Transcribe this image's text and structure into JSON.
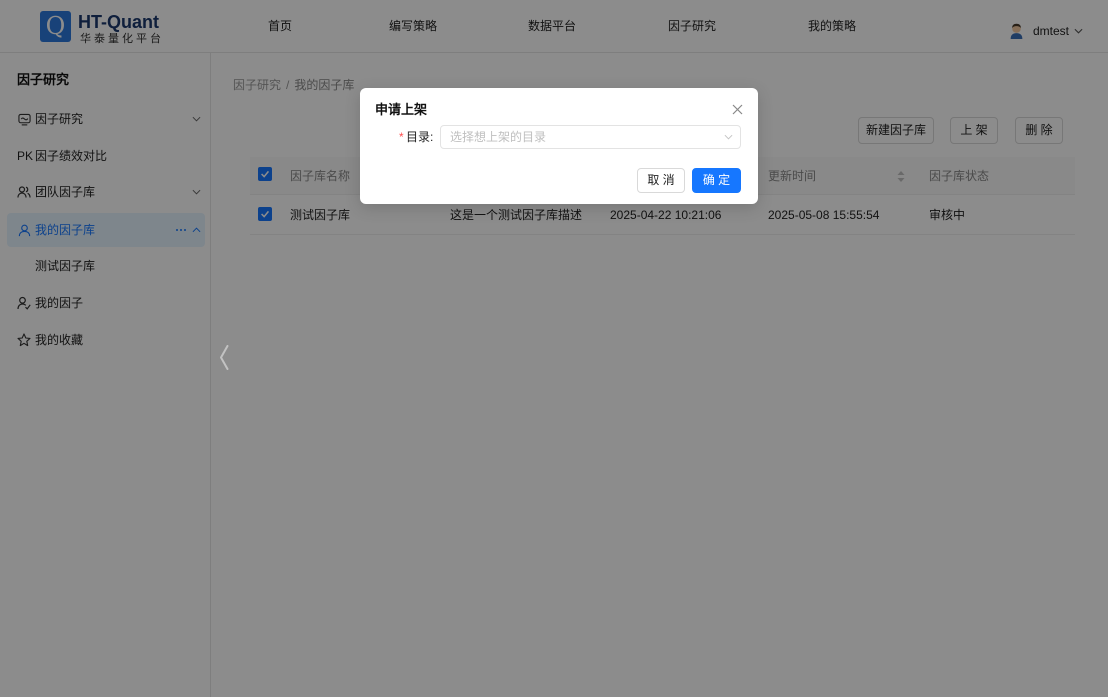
{
  "header": {
    "logo": {
      "mark": "Q",
      "brand": "HT-Quant",
      "subtitle": "华泰量化平台"
    },
    "nav": [
      {
        "label": "首页"
      },
      {
        "label": "编写策略"
      },
      {
        "label": "数据平台"
      },
      {
        "label": "因子研究"
      },
      {
        "label": "我的策略"
      }
    ],
    "user": {
      "name": "dmtest",
      "avatar_icon": "user-avatar-icon",
      "menu_icon": "chevron-down-icon"
    }
  },
  "sidebar": {
    "title": "因子研究",
    "items": [
      {
        "label": "因子研究",
        "icon": "factor-research-icon",
        "expand_icon": "chevron-down-icon"
      },
      {
        "label": "因子绩效对比",
        "icon_text": "PK"
      },
      {
        "label": "团队因子库",
        "icon": "team-icon",
        "expand_icon": "chevron-down-icon"
      },
      {
        "label": "我的因子库",
        "icon": "user-icon",
        "selected": true,
        "more_icon": "ellipsis-icon",
        "expand_icon": "chevron-up-icon"
      },
      {
        "label": "测试因子库"
      },
      {
        "label": "我的因子",
        "icon": "user-check-icon"
      },
      {
        "label": "我的收藏",
        "icon": "star-icon"
      }
    ],
    "collapse_icon": "chevron-left-icon"
  },
  "main": {
    "breadcrumb": {
      "items": [
        "因子研究",
        "我的因子库"
      ],
      "separator": "/"
    },
    "actions": {
      "new_library": "新建因子库",
      "publish": "上 架",
      "delete": "删 除"
    },
    "table": {
      "select_all_checked": true,
      "columns": {
        "name": "因子库名称",
        "updated": "更新时间",
        "status": "因子库状态"
      },
      "sort_icon": "sort-icon",
      "rows": [
        {
          "checked": true,
          "name": "测试因子库",
          "description": "这是一个测试因子库描述",
          "created": "2025-04-22 10:21:06",
          "updated": "2025-05-08 15:55:54",
          "status": "审核中"
        }
      ]
    }
  },
  "modal": {
    "title": "申请上架",
    "close_icon": "close-icon",
    "field": {
      "required_mark": "*",
      "label": "目录:",
      "placeholder": "选择想上架的目录",
      "value": "",
      "dropdown_icon": "chevron-down-icon"
    },
    "cancel_label": "取 消",
    "ok_label": "确 定"
  },
  "colors": {
    "primary": "#1677ff",
    "required": "#ff4d4f",
    "mask": "rgba(0, 0, 0, 0.45)"
  }
}
